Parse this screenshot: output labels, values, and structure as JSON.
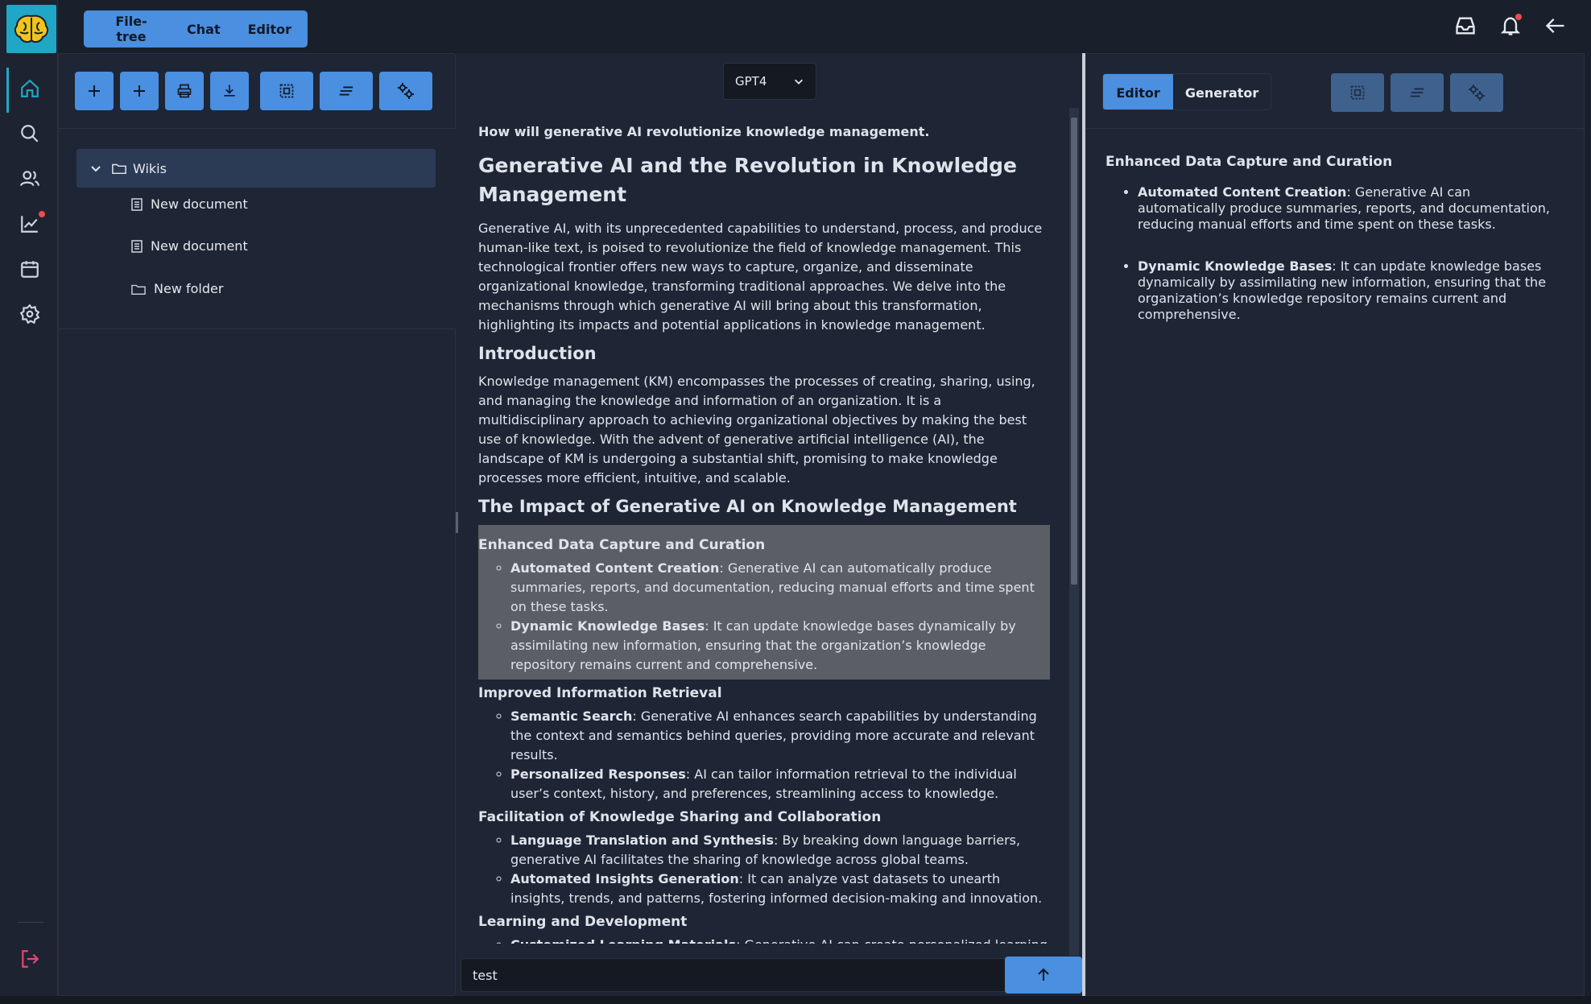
{
  "topbar": {
    "tabs": [
      "File-tree",
      "Chat",
      "Editor"
    ]
  },
  "sidebar": {
    "icons": [
      "home-icon",
      "search-icon",
      "users-icon",
      "chart-icon",
      "calendar-icon",
      "settings-icon",
      "logout-icon"
    ]
  },
  "left_panel": {
    "toolbar": [
      "add-icon",
      "add-icon",
      "print-icon",
      "download-icon",
      "select-icon",
      "format-icon",
      "settings-icon"
    ],
    "tree": {
      "root": "Wikis",
      "children": [
        {
          "type": "document",
          "label": "New document"
        },
        {
          "type": "document",
          "label": "New document"
        },
        {
          "type": "folder",
          "label": "New folder"
        }
      ]
    }
  },
  "center": {
    "model": "GPT4",
    "question": "How will generative AI revolutionize knowledge management.",
    "title": "Generative AI and the Revolution in Knowledge Management",
    "intro_paragraph": "Generative AI, with its unprecedented capabilities to understand, process, and produce human-like text, is poised to revolutionize the field of knowledge management. This technological frontier offers new ways to capture, organize, and disseminate organizational knowledge, transforming traditional approaches. We delve into the mechanisms through which generative AI will bring about this transformation, highlighting its impacts and potential applications in knowledge management.",
    "introduction_heading": "Introduction",
    "introduction_paragraph": "Knowledge management (KM) encompasses the processes of creating, sharing, using, and managing the knowledge and information of an organization. It is a multidisciplinary approach to achieving organizational objectives by making the best use of knowledge. With the advent of generative artificial intelligence (AI), the landscape of KM is undergoing a substantial shift, promising to make knowledge processes more efficient, intuitive, and scalable.",
    "impact_heading": "The Impact of Generative AI on Knowledge Management",
    "sections": [
      {
        "heading": "Enhanced Data Capture and Curation",
        "items": [
          {
            "term": "Automated Content Creation",
            "text": ": Generative AI can automatically produce summaries, reports, and documentation, reducing manual efforts and time spent on these tasks."
          },
          {
            "term": "Dynamic Knowledge Bases",
            "text": ": It can update knowledge bases dynamically by assimilating new information, ensuring that the organization’s knowledge repository remains current and comprehensive."
          }
        ]
      },
      {
        "heading": "Improved Information Retrieval",
        "items": [
          {
            "term": "Semantic Search",
            "text": ": Generative AI enhances search capabilities by understanding the context and semantics behind queries, providing more accurate and relevant results."
          },
          {
            "term": "Personalized Responses",
            "text": ": AI can tailor information retrieval to the individual user’s context, history, and preferences, streamlining access to knowledge."
          }
        ]
      },
      {
        "heading": "Facilitation of Knowledge Sharing and Collaboration",
        "items": [
          {
            "term": "Language Translation and Synthesis",
            "text": ": By breaking down language barriers, generative AI facilitates the sharing of knowledge across global teams."
          },
          {
            "term": "Automated Insights Generation",
            "text": ": It can analyze vast datasets to unearth insights, trends, and patterns, fostering informed decision-making and innovation."
          }
        ]
      },
      {
        "heading": "Learning and Development",
        "items": [
          {
            "term": "Customized Learning Materials",
            "text": ": Generative AI can create personalized learning and"
          }
        ]
      }
    ],
    "chat_input_value": "test"
  },
  "right_panel": {
    "tabs": [
      "Editor",
      "Generator"
    ],
    "heading": "Enhanced Data Capture and Curation",
    "items": [
      {
        "term": "Automated Content Creation",
        "text": ": Generative AI can automatically produce summaries, reports, and documentation, reducing manual efforts and time spent on these tasks."
      },
      {
        "term": "Dynamic Knowledge Bases",
        "text": ": It can update knowledge bases dynamically by assimilating new information, ensuring that the organization’s knowledge repository remains current and comprehensive."
      }
    ]
  },
  "colors": {
    "accent": "#4a8fe0",
    "brand": "#20a7c6",
    "background": "#1e2534",
    "highlight": "#5b5e64",
    "alert": "#f04a4a",
    "logout": "#e8457a"
  }
}
